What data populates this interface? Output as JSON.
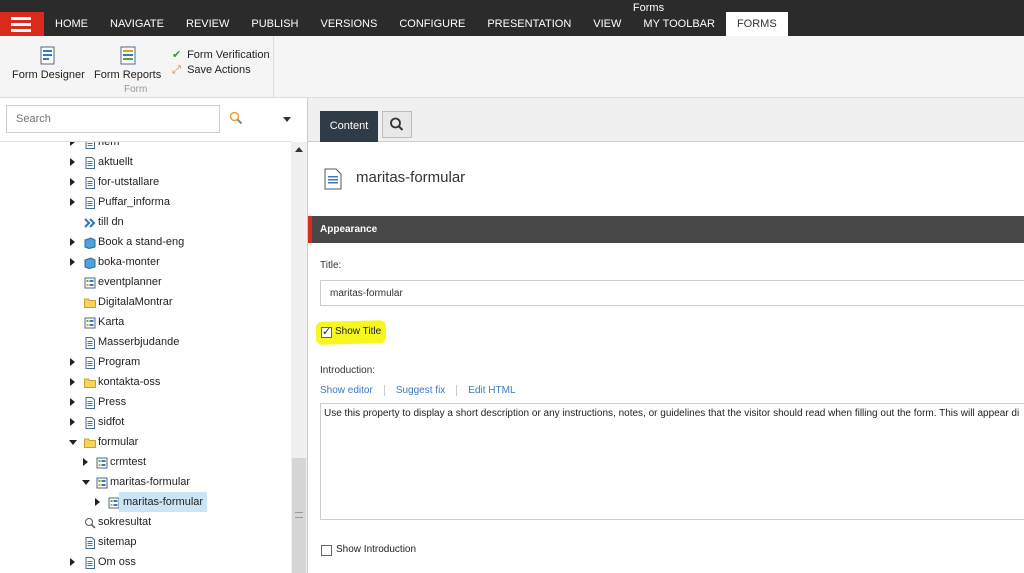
{
  "topbar": {
    "context_label": "Forms",
    "tabs": [
      "HOME",
      "NAVIGATE",
      "REVIEW",
      "PUBLISH",
      "VERSIONS",
      "CONFIGURE",
      "PRESENTATION",
      "VIEW",
      "MY TOOLBAR",
      "FORMS"
    ],
    "active_tab": "FORMS",
    "accent": "#dc291e",
    "background": "#2b2b2b"
  },
  "ribbon": {
    "form_designer": "Form Designer",
    "form_reports": "Form Reports",
    "form_verification": "Form Verification",
    "save_actions": "Save Actions",
    "group_label": "Form"
  },
  "tree": {
    "search_placeholder": "Search",
    "nodes": [
      {
        "label": "hem",
        "icon": "page-icon"
      },
      {
        "label": "aktuellt",
        "icon": "page-icon"
      },
      {
        "label": "for-utstallare",
        "icon": "page-icon"
      },
      {
        "label": "Puffar_informa",
        "icon": "page-icon"
      },
      {
        "label": "till dn",
        "icon": "redirect-icon"
      },
      {
        "label": "Book a stand-eng",
        "icon": "book-icon"
      },
      {
        "label": "boka-monter",
        "icon": "book-icon"
      },
      {
        "label": "eventplanner",
        "icon": "form-icon"
      },
      {
        "label": "DigitalaMontrar",
        "icon": "folder-icon"
      },
      {
        "label": "Karta",
        "icon": "form-icon"
      },
      {
        "label": "Masserbjudande",
        "icon": "page-icon"
      },
      {
        "label": "Program",
        "icon": "page-icon"
      },
      {
        "label": "kontakta-oss",
        "icon": "folder-icon"
      },
      {
        "label": "Press",
        "icon": "page-icon"
      },
      {
        "label": "sidfot",
        "icon": "page-icon"
      },
      {
        "label": "formular",
        "icon": "folder-icon"
      },
      {
        "label": "crmtest",
        "icon": "form-icon"
      },
      {
        "label": "maritas-formular",
        "icon": "form-icon"
      },
      {
        "label": "maritas-formular",
        "icon": "form-icon"
      },
      {
        "label": "sokresultat",
        "icon": "search-page-icon"
      },
      {
        "label": "sitemap",
        "icon": "page-icon"
      },
      {
        "label": "Om oss",
        "icon": "page-icon"
      }
    ]
  },
  "editor": {
    "content_tab": "Content",
    "item_title": "maritas-formular",
    "section_title": "Appearance",
    "title_label": "Title:",
    "title_value": "maritas-formular",
    "show_title_label": "Show Title",
    "show_title_checked": true,
    "introduction_label": "Introduction:",
    "links": [
      "Show editor",
      "Suggest fix",
      "Edit HTML"
    ],
    "introduction_text": "Use this property to display a short description or any instructions, notes, or guidelines that the visitor should read when filling out the form. This will appear di",
    "show_introduction_label": "Show Introduction",
    "show_introduction_checked": false
  }
}
